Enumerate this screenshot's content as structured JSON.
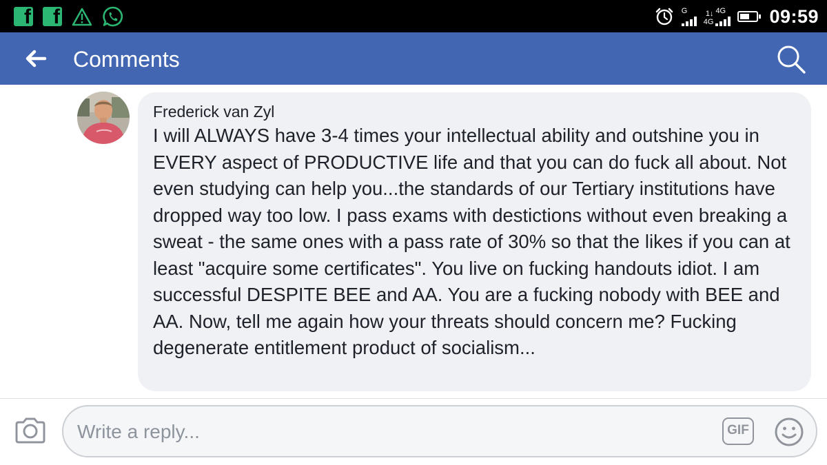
{
  "status_bar": {
    "time": "09:59",
    "sim1_network": "G",
    "sim2_network_top": "4G",
    "sim2_network_bottom": "4G",
    "sim2_arrows": "1↓",
    "notification_icons": [
      "facebook-icon",
      "facebook-icon",
      "warning-icon",
      "whatsapp-icon"
    ],
    "status_icons": [
      "alarm-icon",
      "signal-icon",
      "signal-icon",
      "battery-icon"
    ],
    "battery_level": 0.6
  },
  "app_bar": {
    "title": "Comments",
    "back_icon": "arrow-left-icon",
    "search_icon": "search-icon",
    "color": "#4266b2"
  },
  "comment": {
    "author": "Frederick van Zyl",
    "text": "I will ALWAYS have 3-4 times your intellectual ability and outshine you in EVERY aspect of PRODUCTIVE life and that you can do fuck all about. Not even studying can help you...the standards of our Tertiary institutions have dropped way too low. I pass exams with destictions without even breaking a sweat - the same ones with a pass rate of 30% so that the likes if you can at least \"acquire some certificates\". You live on fucking handouts idiot. I am successful DESPITE BEE and AA. You are a fucking nobody with BEE and AA. Now, tell me again how your threats should concern me? Fucking degenerate entitlement product of socialism...",
    "bubble_color": "#f0f1f4"
  },
  "reply_bar": {
    "placeholder": "Write a reply...",
    "value": "",
    "gif_label": "GIF",
    "camera_icon": "camera-icon",
    "emoji_icon": "smiley-icon"
  }
}
